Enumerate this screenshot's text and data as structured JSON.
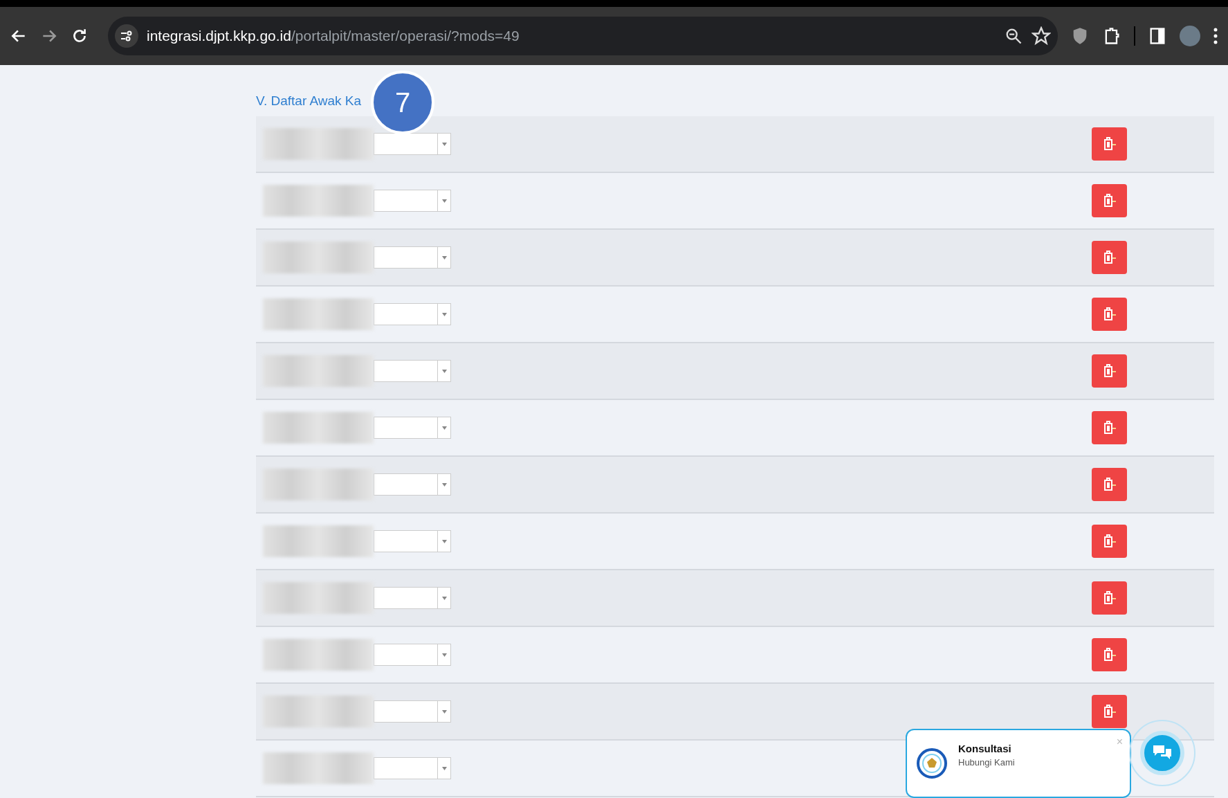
{
  "browser": {
    "url_host": "integrasi.djpt.kkp.go.id",
    "url_path": "/portalpit/master/operasi/?mods=49"
  },
  "section": {
    "title": "V. Daftar Awak Ka",
    "step_badge": "7"
  },
  "rows": [
    {
      "kind": "crew"
    },
    {
      "kind": "crew"
    },
    {
      "kind": "crew"
    },
    {
      "kind": "crew"
    },
    {
      "kind": "crew"
    },
    {
      "kind": "crew"
    },
    {
      "kind": "crew"
    },
    {
      "kind": "crew"
    },
    {
      "kind": "crew"
    },
    {
      "kind": "crew"
    },
    {
      "kind": "crew"
    },
    {
      "kind": "crew"
    }
  ],
  "chat_widget": {
    "title": "Konsultasi",
    "subtitle": "Hubungi Kami",
    "close": "×"
  }
}
